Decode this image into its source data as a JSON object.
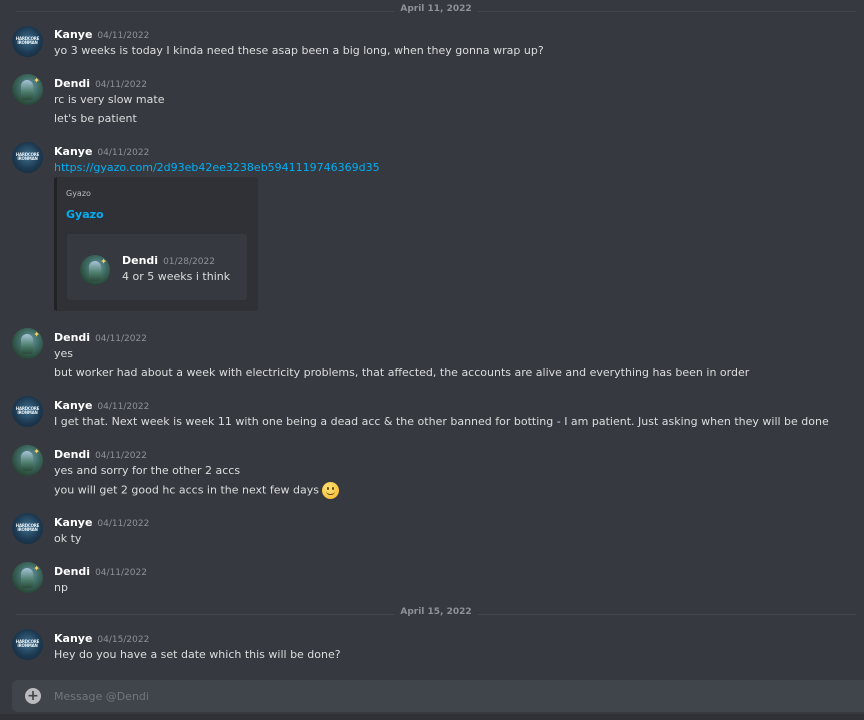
{
  "dividers": [
    {
      "label": "April 11, 2022"
    },
    {
      "label": "April 15, 2022"
    }
  ],
  "messages": [
    {
      "author": "Kanye",
      "timestamp": "04/11/2022",
      "lines": [
        "yo 3 weeks is today I kinda need these asap been a big long, when they gonna wrap up?"
      ]
    },
    {
      "author": "Dendi",
      "timestamp": "04/11/2022",
      "lines": [
        "rc is very slow mate",
        "let's be patient"
      ]
    },
    {
      "author": "Kanye",
      "timestamp": "04/11/2022",
      "link": "https://gyazo.com/2d93eb42ee3238eb5941119746369d35",
      "embed": {
        "provider": "Gyazo",
        "title": "Gyazo",
        "quoted_author": "Dendi",
        "quoted_timestamp": "01/28/2022",
        "quoted_text": "4 or 5 weeks i think"
      }
    },
    {
      "author": "Dendi",
      "timestamp": "04/11/2022",
      "lines": [
        "yes",
        "but  worker had about a week with electricity problems, that affected, the accounts are alive and everything has been in order"
      ]
    },
    {
      "author": "Kanye",
      "timestamp": "04/11/2022",
      "lines": [
        "I get that. Next week is week 11 with one being a dead acc & the other banned for botting - I am patient. Just asking when they will be done"
      ]
    },
    {
      "author": "Dendi",
      "timestamp": "04/11/2022",
      "lines": [
        "yes and sorry for the other 2 accs",
        "you will get 2 good hc accs in the next few days"
      ],
      "emoji": "slightly-smiling-face"
    },
    {
      "author": "Kanye",
      "timestamp": "04/11/2022",
      "lines": [
        "ok ty"
      ]
    },
    {
      "author": "Dendi",
      "timestamp": "04/11/2022",
      "lines": [
        "np"
      ]
    },
    {
      "author": "Kanye",
      "timestamp": "04/15/2022",
      "lines": [
        "Hey do you have a set date which this will be done?"
      ]
    }
  ],
  "avatars": {
    "kanye_text": "HARDCORE IRONMAN"
  },
  "composer": {
    "placeholder": "Message @Dendi",
    "value": ""
  },
  "colors": {
    "background": "#36393f",
    "link": "#00aff4",
    "composer": "#40444b"
  }
}
